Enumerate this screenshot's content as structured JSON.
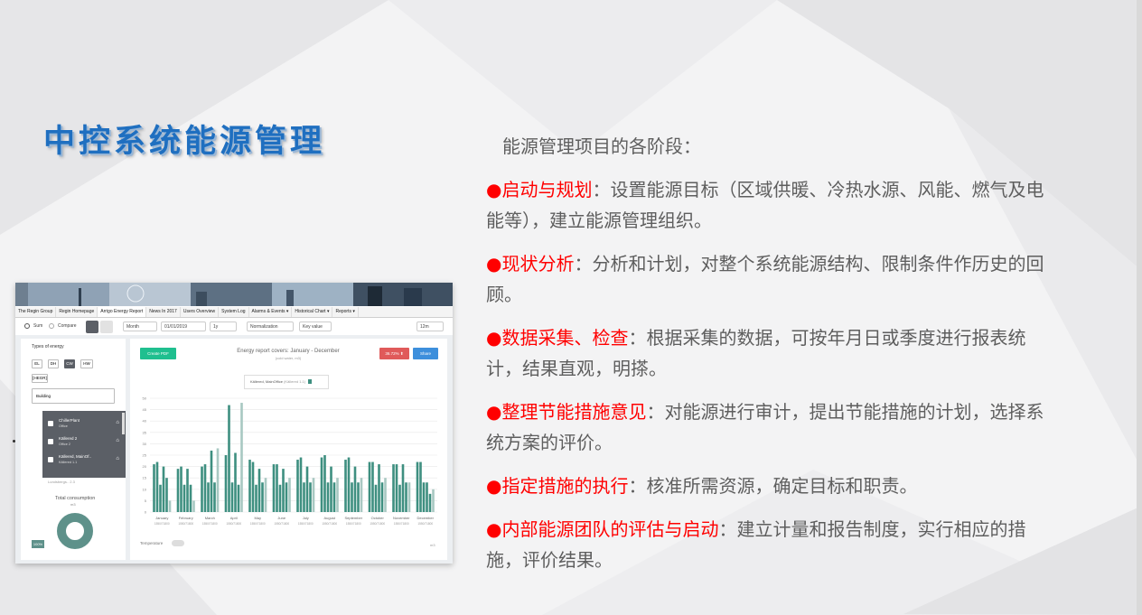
{
  "slide": {
    "title": "中控系统能源管理",
    "intro": "能源管理项目的各阶段：",
    "items": [
      {
        "bullet": "●",
        "head": "启动与规划",
        "body": "：设置能源目标（区域供暖、冷热水源、风能、燃气及电能等），建立能源管理组织。"
      },
      {
        "bullet": "●",
        "head": "现状分析",
        "body": "：分析和计划，对整个系统能源结构、限制条件作历史的回顾。"
      },
      {
        "bullet": "●",
        "head": "数据采集、检查",
        "body": "：根据采集的数据，可按年月日或季度进行报表统计，结果直观，明搽。"
      },
      {
        "bullet": "●",
        "head": "整理节能措施意见",
        "body": "：对能源进行审计，提出节能措施的计划，选择系统方案的评价。"
      },
      {
        "bullet": "●",
        "head": "指定措施的执行",
        "body": "：核准所需资源，确定目标和职责。"
      },
      {
        "bullet": "●",
        "head": "内部能源团队的评估与启动",
        "body": "：建立计量和报告制度，实行相应的措施，评价结果。"
      }
    ],
    "colors": {
      "title": "#1f6fc0",
      "highlight": "#ff0000",
      "body_text": "#5e5e5e"
    }
  },
  "app": {
    "tabs": [
      "The Regin Group",
      "Regin Homepage",
      "Arrigo Energy Report",
      "News In 2017",
      "Users Overview",
      "System Log",
      "Alarms & Events ▾",
      "Historical Chart ▾",
      "Reports ▾"
    ],
    "toolbar": {
      "sum": "Sum",
      "compare": "Compare",
      "month": "Month",
      "date": "01/01/2019",
      "period": "1y",
      "normalization": "Normalization",
      "key_value": "Key value",
      "range": "12m"
    },
    "sidebar": {
      "types_label": "Types of energy",
      "energy_types": [
        "EL",
        "DH",
        "CW",
        "HW"
      ],
      "extra_type": "[HEGR]",
      "select": "Building",
      "tree_header": "Building",
      "buildings": [
        {
          "name": "ChillerPlant",
          "sub": "Office"
        },
        {
          "name": "Källered 2",
          "sub": "Office 2"
        },
        {
          "name": "Källered, MainOf..",
          "sub": "Källered 1.1"
        }
      ],
      "more": "Lundsbergs.. 2.3",
      "total_label": "Total consumption",
      "total_unit": "m3",
      "percent_badge": "100%"
    },
    "main": {
      "create_pdf": "Create PDF",
      "report_title": "Energy report covers: January - December",
      "report_sub": "(cold water, m3)",
      "badge_pct": "36.72% ⬆",
      "share": "Share",
      "legend": "Källered, MainOffice",
      "legend_sub": "(Källered 1.1)",
      "temperature": "Temperature",
      "unit": "m3"
    }
  },
  "chart_data": {
    "type": "bar",
    "categories": [
      "January",
      "February",
      "March",
      "April",
      "May",
      "June",
      "July",
      "August",
      "September",
      "October",
      "November",
      "December"
    ],
    "sublabel": "1550/71800",
    "ylim": [
      0,
      50
    ],
    "yticks": [
      0,
      5,
      10,
      15,
      20,
      25,
      30,
      35,
      40,
      45,
      50
    ],
    "series": [
      {
        "values": [
          21,
          19,
          20,
          25,
          23,
          21,
          23,
          24,
          23,
          22,
          21,
          22
        ],
        "color": "#3e8f80"
      },
      {
        "values": [
          22,
          20,
          21,
          47,
          22,
          21,
          24,
          25,
          24,
          22,
          21,
          22
        ],
        "color": "#3e8f80"
      },
      {
        "values": [
          12,
          12,
          13,
          13,
          12,
          12,
          13,
          13,
          13,
          12,
          12,
          13
        ],
        "color": "#3e8f80"
      },
      {
        "values": [
          20,
          19,
          27,
          26,
          19,
          19,
          20,
          20,
          20,
          21,
          21,
          13
        ],
        "color": "#3e8f80"
      },
      {
        "values": [
          15,
          12,
          13,
          12,
          13,
          13,
          13,
          13,
          13,
          13,
          13,
          8
        ],
        "color": "#3e8f80"
      },
      {
        "values": [
          5,
          5,
          28,
          48,
          15,
          15,
          15,
          15,
          15,
          15,
          13,
          10
        ],
        "color": "#a8c8c2"
      }
    ]
  }
}
